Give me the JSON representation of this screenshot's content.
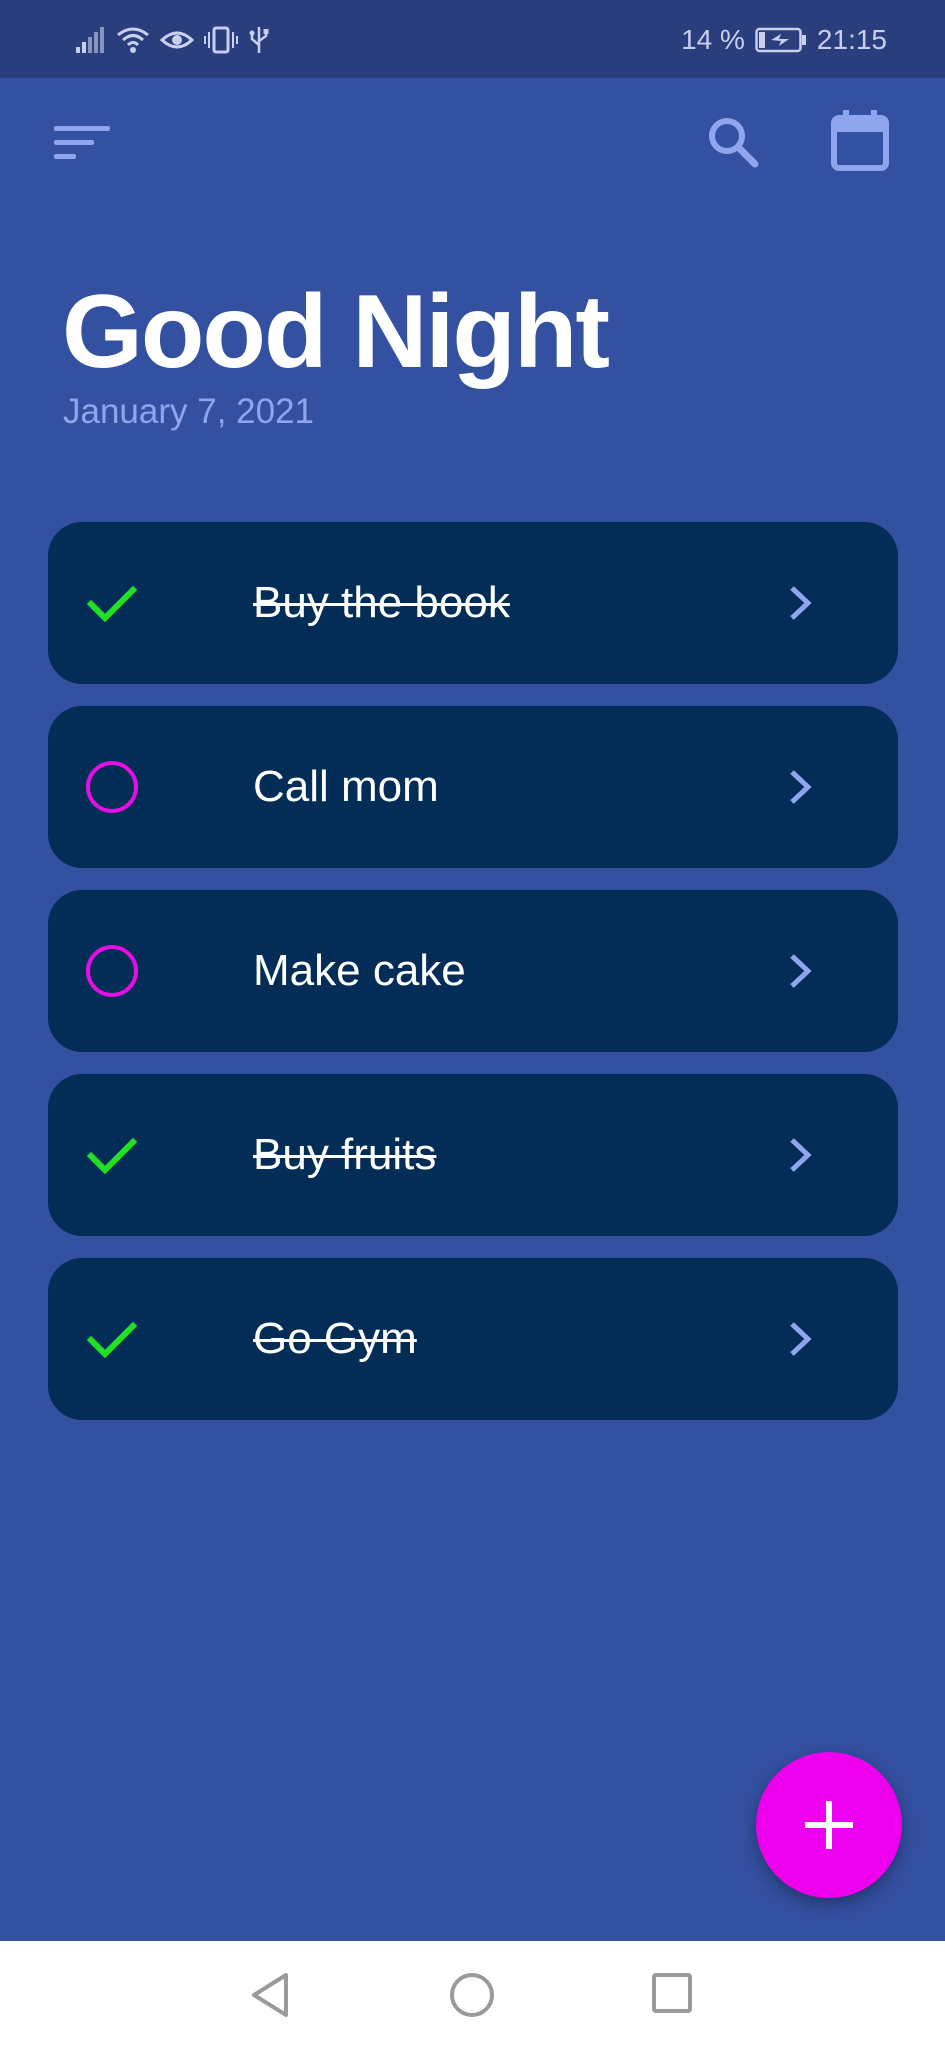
{
  "status_bar": {
    "battery_percent": "14 %",
    "time": "21:15",
    "left_icons": [
      "signal-icon",
      "wifi-icon",
      "eye-icon",
      "vibrate-icon",
      "usb-icon"
    ],
    "right_icons": [
      "battery-charging-icon"
    ]
  },
  "header": {
    "menu_icon": "menu-icon",
    "search_icon": "search-icon",
    "calendar_icon": "calendar-icon"
  },
  "greeting": {
    "title": "Good Night",
    "date": "January 7, 2021"
  },
  "tasks": [
    {
      "label": "Buy the book",
      "done": true
    },
    {
      "label": "Call mom",
      "done": false
    },
    {
      "label": "Make cake",
      "done": false
    },
    {
      "label": "Buy fruits",
      "done": true
    },
    {
      "label": "Go Gym",
      "done": true
    }
  ],
  "fab": {
    "icon": "plus-icon"
  },
  "nav": {
    "icons": [
      "back-icon",
      "home-icon",
      "recents-icon"
    ]
  },
  "colors": {
    "background": "#3450a1",
    "status_bar": "#2a3d7c",
    "card": "#032c57",
    "accent_magenta": "#ee00ef",
    "done_check": "#22e022",
    "secondary_text": "#8fa6ee",
    "icon_blue": "#8fa6ee"
  }
}
